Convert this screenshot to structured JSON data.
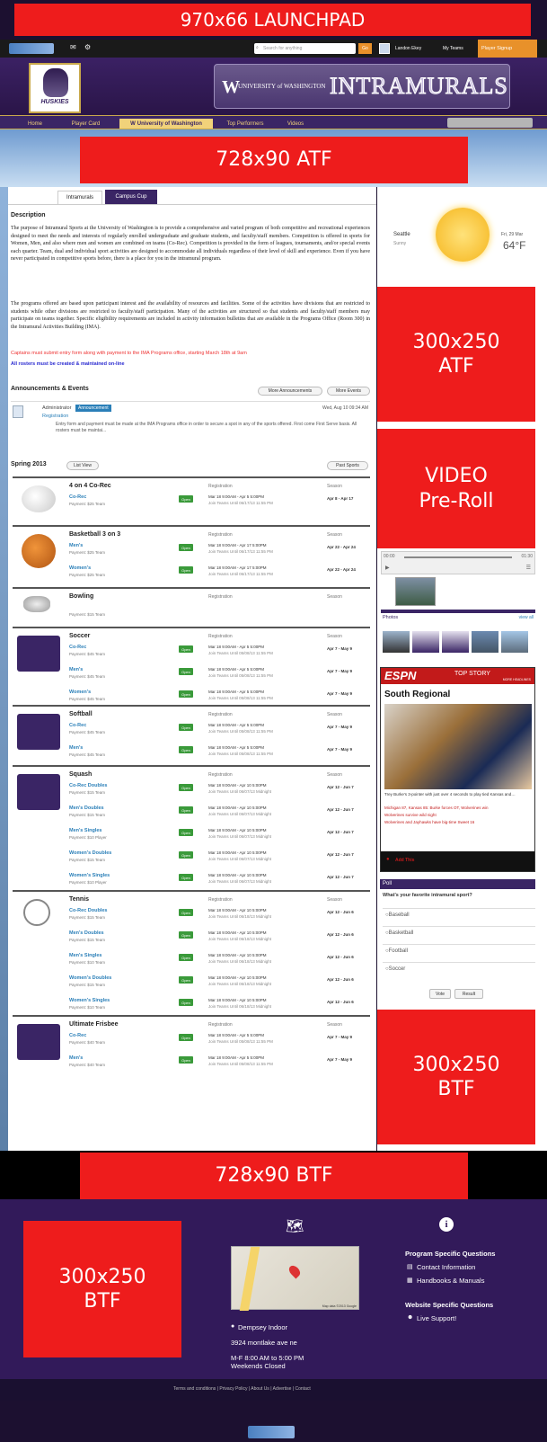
{
  "ads": {
    "launchpad": "970x66 LAUNCHPAD",
    "atf_728": "728x90 ATF",
    "atf_300": "300x250\nATF",
    "video": "VIDEO\nPre-Roll",
    "btf_300_side": "300x250\nBTF",
    "btf_728": "728x90 BTF",
    "btf_300_footer": "300x250\nBTF"
  },
  "topbar": {
    "search_placeholder": "Search for anything",
    "search_button": "Go",
    "user_name": "Landon Ekey",
    "my_teams": "My Teams",
    "player_signup": "Player Signup"
  },
  "header": {
    "mascot": "HUSKIES",
    "university": "UNIVERSITY of WASHINGTON",
    "banner": "INTRAMURALS"
  },
  "nav": {
    "items": [
      "Home",
      "Player Card",
      "University of Washington",
      "Top Performers",
      "Videos"
    ]
  },
  "tabs": {
    "intramurals": "Intramurals",
    "campus_cup": "Campus Cup"
  },
  "description": {
    "title": "Description",
    "p1": "The purpose of Intramural Sports at the University of Washington is to provide a comprehensive and varied program of both competitive and recreational experiences designed to meet the needs and interests of regularly enrolled undergraduate and graduate students, and faculty/staff members. Competition is offered in sports for Women, Men, and also where men and women are combined on teams (Co-Rec). Competition is provided in the form of leagues, tournaments, and/or special events each quarter. Team, dual and individual sport activities are designed to accommodate all individuals regardless of their level of skill and experience. Even if you have never participated in competitive sports before, there is a place for you in the intramural program.",
    "p2": "The programs offered are based upon participant interest and the availability of resources and facilities. Some of the activities have divisions that are restricted to students while other divisions are restricted to faculty/staff participation. Many of the activities are structured so that students and faculty/staff members may participate on teams together. Specific eligibility requirements are included in activity information bulletins that are available in the Programs Office (Room 300) in the Intramural Activities Building (IMA).",
    "note_red": "Captains must submit entry form along with payment to the IMA Programs office, starting March 18th at 9am",
    "note_blue": "All rosters must be created & maintained on-line"
  },
  "announcements": {
    "title": "Announcements & Events",
    "more_announcements": "More Announcements",
    "more_events": "More Events",
    "author": "Administrator",
    "badge": "Announcement",
    "date": "Wed, Aug 10 09:34 AM",
    "heading": "Registration",
    "body": "Entry form and payment must be made at the IMA Programs office in order to secure a spot in any of the sports offered. First come First Serve basis. All rosters must be maintai..."
  },
  "season": {
    "title": "Spring 2013",
    "list_view": "List View",
    "past_sports": "Past Sports",
    "col_registration": "Registration",
    "col_season": "Season",
    "open_label": "Open",
    "sports": [
      {
        "name": "4 on 4 Co-Rec",
        "rows": [
          {
            "div": "Co-Rec",
            "pay": "Payment: $25 Team",
            "r1": "Mar 18 9:00AM - Apr 5 5:00PM",
            "r2": "Join Teams Until 06/17/13 11:55 PM",
            "season": "Apr 8 - Apr 17"
          }
        ]
      },
      {
        "name": "Basketball 3 on 3",
        "rows": [
          {
            "div": "Men's",
            "pay": "Payment: $25 Team",
            "r1": "Mar 18 9:00AM - Apr 17 5:00PM",
            "r2": "Join Teams Until 06/17/13 11:55 PM",
            "season": "Apr 22 - Apr 24"
          },
          {
            "div": "Women's",
            "pay": "Payment: $25 Team",
            "r1": "Mar 18 9:00AM - Apr 17 5:00PM",
            "r2": "Join Teams Until 06/17/13 11:55 PM",
            "season": "Apr 22 - Apr 24"
          }
        ]
      },
      {
        "name": "Bowling",
        "rows": [
          {
            "div": "",
            "pay": "Payment: $15 Team",
            "r1": "",
            "r2": "",
            "season": ""
          }
        ]
      },
      {
        "name": "Soccer",
        "rows": [
          {
            "div": "Co-Rec",
            "pay": "Payment: $45 Team",
            "r1": "Mar 18 9:00AM - Apr 5 5:00PM",
            "r2": "Join Teams Until 05/08/13 11:55 PM",
            "season": "Apr 7 - May 9"
          },
          {
            "div": "Men's",
            "pay": "Payment: $45 Team",
            "r1": "Mar 18 9:00AM - Apr 5 5:00PM",
            "r2": "Join Teams Until 05/08/13 11:55 PM",
            "season": "Apr 7 - May 9"
          },
          {
            "div": "Women's",
            "pay": "Payment: $45 Team",
            "r1": "Mar 18 9:00AM - Apr 5 5:00PM",
            "r2": "Join Teams Until 05/08/13 11:55 PM",
            "season": "Apr 7 - May 9"
          }
        ]
      },
      {
        "name": "Softball",
        "rows": [
          {
            "div": "Co-Rec",
            "pay": "Payment: $45 Team",
            "r1": "Mar 18 9:00AM - Apr 5 5:00PM",
            "r2": "Join Teams Until 05/08/13 11:55 PM",
            "season": "Apr 7 - May 9"
          },
          {
            "div": "Men's",
            "pay": "Payment: $45 Team",
            "r1": "Mar 18 9:00AM - Apr 5 5:00PM",
            "r2": "Join Teams Until 05/08/13 11:55 PM",
            "season": "Apr 7 - May 9"
          }
        ]
      },
      {
        "name": "Squash",
        "rows": [
          {
            "div": "Co-Rec Doubles",
            "pay": "Payment: $15 Team",
            "r1": "Mar 18 9:00AM - Apr 10 5:00PM",
            "r2": "Join Teams Until 06/07/13 Midnight",
            "season": "Apr 12 - Jun 7"
          },
          {
            "div": "Men's Doubles",
            "pay": "Payment: $15 Team",
            "r1": "Mar 18 9:00AM - Apr 10 5:00PM",
            "r2": "Join Teams Until 06/07/13 Midnight",
            "season": "Apr 12 - Jun 7"
          },
          {
            "div": "Men's Singles",
            "pay": "Payment: $10 Player",
            "r1": "Mar 18 9:00AM - Apr 10 5:00PM",
            "r2": "Join Teams Until 06/07/13 Midnight",
            "season": "Apr 12 - Jun 7"
          },
          {
            "div": "Women's Doubles",
            "pay": "Payment: $15 Team",
            "r1": "Mar 18 9:00AM - Apr 10 5:00PM",
            "r2": "Join Teams Until 06/07/13 Midnight",
            "season": "Apr 12 - Jun 7"
          },
          {
            "div": "Women's Singles",
            "pay": "Payment: $10 Player",
            "r1": "Mar 18 9:00AM - Apr 10 5:00PM",
            "r2": "Join Teams Until 06/07/13 Midnight",
            "season": "Apr 12 - Jun 7"
          }
        ]
      },
      {
        "name": "Tennis",
        "rows": [
          {
            "div": "Co-Rec Doubles",
            "pay": "Payment: $15 Team",
            "r1": "Mar 18 9:00AM - Apr 10 5:00PM",
            "r2": "Join Teams Until 06/18/13 Midnight",
            "season": "Apr 12 - Jun 6"
          },
          {
            "div": "Men's Doubles",
            "pay": "Payment: $15 Team",
            "r1": "Mar 18 9:00AM - Apr 10 5:00PM",
            "r2": "Join Teams Until 06/18/13 Midnight",
            "season": "Apr 12 - Jun 6"
          },
          {
            "div": "Men's Singles",
            "pay": "Payment: $10 Team",
            "r1": "Mar 18 9:00AM - Apr 10 5:00PM",
            "r2": "Join Teams Until 06/18/13 Midnight",
            "season": "Apr 12 - Jun 6"
          },
          {
            "div": "Women's Doubles",
            "pay": "Payment: $15 Team",
            "r1": "Mar 18 9:00AM - Apr 10 5:00PM",
            "r2": "Join Teams Until 06/18/13 Midnight",
            "season": "Apr 12 - Jun 6"
          },
          {
            "div": "Women's Singles",
            "pay": "Payment: $10 Team",
            "r1": "Mar 18 9:00AM - Apr 10 5:00PM",
            "r2": "Join Teams Until 06/18/13 Midnight",
            "season": "Apr 12 - Jun 6"
          }
        ]
      },
      {
        "name": "Ultimate Frisbee",
        "rows": [
          {
            "div": "Co-Rec",
            "pay": "Payment: $40 Team",
            "r1": "Mar 18 9:00AM - Apr 5 5:00PM",
            "r2": "Join Teams Until 05/08/13 11:55 PM",
            "season": "Apr 7 - May 9"
          },
          {
            "div": "Men's",
            "pay": "Payment: $40 Team",
            "r1": "Mar 18 9:00AM - Apr 5 5:00PM",
            "r2": "Join Teams Until 05/08/13 11:55 PM",
            "season": "Apr 7 - May 9"
          }
        ]
      }
    ]
  },
  "weather": {
    "city": "Seattle",
    "condition": "Sunny",
    "date": "Fri, 29 Mar",
    "temp": "64°F"
  },
  "video_player": {
    "time_start": "00:00",
    "time_end": "01:30",
    "photos_label": "Photos",
    "view_all": "view all"
  },
  "espn": {
    "brand": "ESPN",
    "top_story": "TOP STORY",
    "more_headlines": "MORE HEADLINES",
    "headline": "South Regional",
    "caption": "Trey Burke's 3-pointer with just over 4 seconds to play tied Kansas and…",
    "links": [
      "Michigan 87, Kansas 85: Burke forces OT, Wolverines win",
      "Wolverines survive wild night",
      "Wolverines and Jayhawks have big-time Sweet 16"
    ],
    "add_this": "Add This"
  },
  "poll": {
    "title": "Poll",
    "question": "What's your favorite intramural sport?",
    "options": [
      "Baseball",
      "Basketball",
      "Football",
      "Soccer"
    ],
    "vote": "Vote",
    "result": "Result"
  },
  "footer": {
    "location": "Dempsey Indoor",
    "address": "3924 montlake ave ne",
    "hours": "M-F 8:00 AM to 5:00 PM",
    "weekends": "Weekends Closed",
    "program_q": "Program Specific Questions",
    "contact": "Contact Information",
    "handbooks": "Handbooks & Manuals",
    "website_q": "Website Specific Questions",
    "live_support": "Live Support!",
    "map_credit": "Map data ©2013 Google",
    "links": "Terms and conditions | Privacy Policy | About Us | Advertise | Contact"
  },
  "colors": {
    "ad_red": "#ee1c1c",
    "uw_purple": "#3a2565",
    "uw_gold": "#c8a84b",
    "link_blue": "#2a7fb8",
    "open_green": "#3a9a3a"
  }
}
